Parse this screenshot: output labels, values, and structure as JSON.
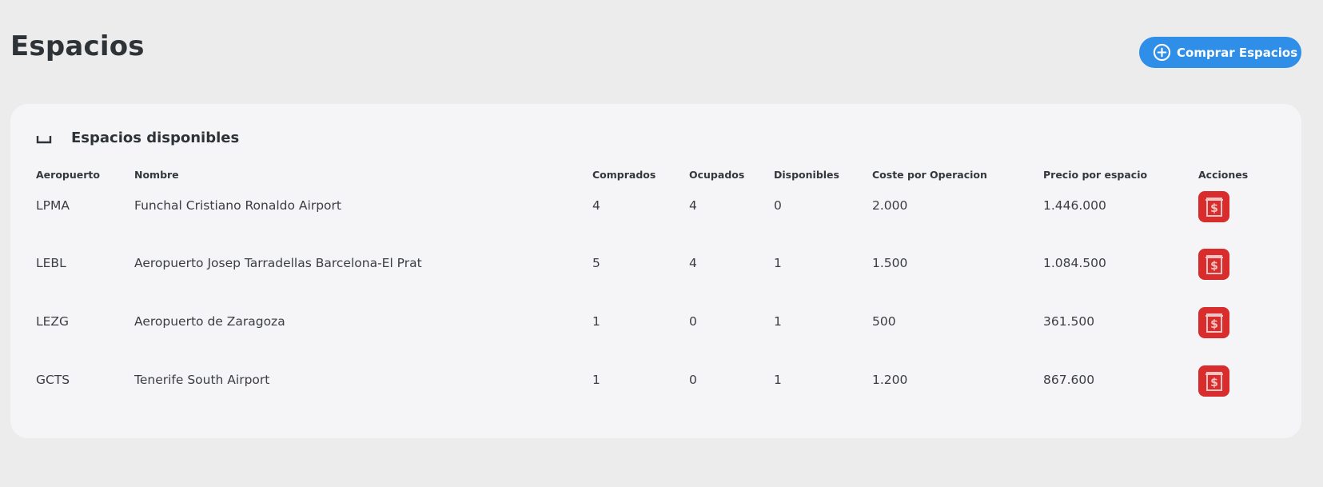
{
  "page": {
    "title": "Espacios"
  },
  "header": {
    "buy_button_label": "Comprar Espacios",
    "buy_button_icon": "plus-circle-icon"
  },
  "card": {
    "title": "Espacios disponibles",
    "title_icon": "space-bar-icon"
  },
  "table": {
    "columns": [
      "Aeropuerto",
      "Nombre",
      "Comprados",
      "Ocupados",
      "Disponibles",
      "Coste por Operacion",
      "Precio por espacio",
      "Acciones"
    ],
    "rows": [
      {
        "aeropuerto": "LPMA",
        "nombre": "Funchal Cristiano Ronaldo Airport",
        "comprados": "4",
        "ocupados": "4",
        "disponibles": "0",
        "coste": "2.000",
        "precio": "1.446.000",
        "action_icon": "money-bill-icon"
      },
      {
        "aeropuerto": "LEBL",
        "nombre": "Aeropuerto Josep Tarradellas Barcelona-El Prat",
        "comprados": "5",
        "ocupados": "4",
        "disponibles": "1",
        "coste": "1.500",
        "precio": "1.084.500",
        "action_icon": "money-bill-icon"
      },
      {
        "aeropuerto": "LEZG",
        "nombre": "Aeropuerto de Zaragoza",
        "comprados": "1",
        "ocupados": "0",
        "disponibles": "1",
        "coste": "500",
        "precio": "361.500",
        "action_icon": "money-bill-icon"
      },
      {
        "aeropuerto": "GCTS",
        "nombre": "Tenerife South Airport",
        "comprados": "1",
        "ocupados": "0",
        "disponibles": "1",
        "coste": "1.200",
        "precio": "867.600",
        "action_icon": "money-bill-icon"
      }
    ]
  },
  "colors": {
    "background": "#ececec",
    "card": "#f5f5f7",
    "primary": "#2f8fe8",
    "danger": "#d92c2c",
    "text": "#2f3237"
  }
}
